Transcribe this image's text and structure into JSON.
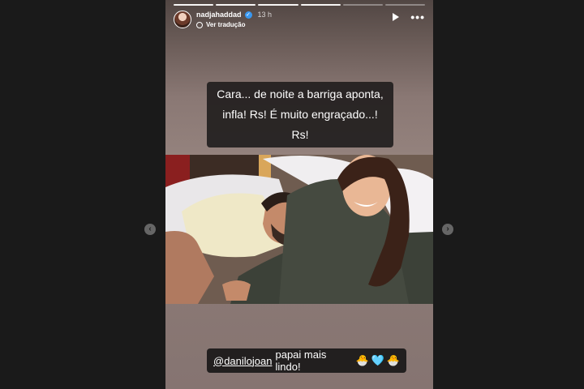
{
  "story": {
    "progress_segments": 6,
    "progress_completed": 4,
    "username": "nadjahaddad",
    "time_ago": "13 h",
    "translate_label": "Ver tradução",
    "caption": "Cara... de noite a barriga aponta, infla! Rs! É muito engraçado...! Rs!",
    "mention": "@danilojoan",
    "mention_text": "papai mais lindo!",
    "emojis": [
      "🐣",
      "🩵",
      "🐣"
    ]
  },
  "nav": {
    "prev_icon": "chevron-left-icon",
    "next_icon": "chevron-right-icon"
  },
  "colors": {
    "verified": "#3897f0",
    "page_bg": "#1a1a1a"
  }
}
